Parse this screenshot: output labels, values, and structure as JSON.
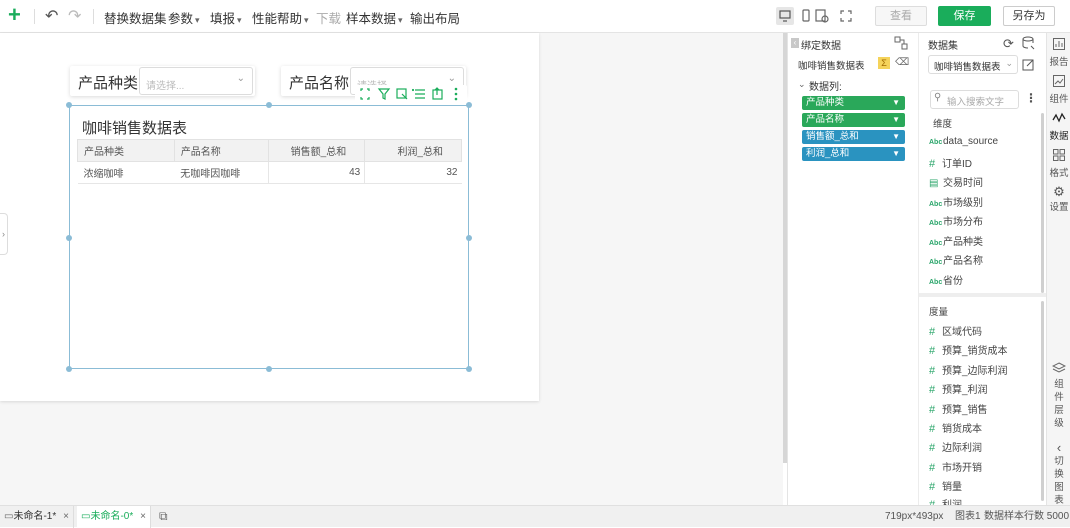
{
  "toolbar": {
    "add": "+",
    "undo": "↶",
    "redo": "↷",
    "menu": [
      "替换数据集",
      "参数",
      "填报",
      "性能帮助",
      "下载",
      "样本数据",
      "输出布局"
    ],
    "view_btn": "查看",
    "save_btn": "保存",
    "save_as_btn": "另存为"
  },
  "canvas": {
    "filter1": {
      "label": "产品种类",
      "placeholder": "请选择..."
    },
    "filter2": {
      "label": "产品名称",
      "placeholder": "请选择..."
    },
    "table_title": "咖啡销售数据表",
    "columns": [
      "产品种类",
      "产品名称",
      "销售额_总和",
      "利润_总和"
    ],
    "rows": [
      [
        "浓缩咖啡",
        "无咖啡因咖啡",
        "43",
        "32"
      ]
    ]
  },
  "bind_panel": {
    "title": "绑定数据",
    "dataset_name": "咖啡销售数据表",
    "section": "数据列:",
    "fields": [
      {
        "label": "产品种类",
        "color": "#2aa85a"
      },
      {
        "label": "产品名称",
        "color": "#2aa85a"
      },
      {
        "label": "销售额_总和",
        "color": "#2a93c0"
      },
      {
        "label": "利润_总和",
        "color": "#2a93c0"
      }
    ]
  },
  "dataset_panel": {
    "title": "数据集",
    "selected": "咖啡销售数据表",
    "search_placeholder": "输入搜索文字",
    "dim_title": "维度",
    "dimensions": [
      {
        "type": "Abc",
        "name": "data_source"
      },
      {
        "type": "#",
        "name": "订单ID"
      },
      {
        "type": "date",
        "name": "交易时间"
      },
      {
        "type": "Abc",
        "name": "市场级别"
      },
      {
        "type": "Abc",
        "name": "市场分布"
      },
      {
        "type": "Abc",
        "name": "产品种类"
      },
      {
        "type": "Abc",
        "name": "产品名称"
      },
      {
        "type": "Abc",
        "name": "省份"
      }
    ],
    "measure_title": "度量",
    "measures": [
      "区域代码",
      "预算_销货成本",
      "预算_边际利润",
      "预算_利润",
      "预算_销售",
      "销货成本",
      "边际利润",
      "市场开销",
      "销量",
      "利润"
    ]
  },
  "rail": {
    "report": "报告",
    "component": "组件",
    "data": "数据",
    "format": "格式",
    "settings": "设置",
    "layers": "组件层级",
    "switch": "切换图表"
  },
  "status": {
    "tab1": "未命名-1*",
    "tab2": "未命名-0*",
    "size": "719px*493px",
    "chart": "图表1",
    "rows": "数据样本行数 5000"
  },
  "colors": {
    "accent": "#1aad5b",
    "selection": "#8bbcd6",
    "dim": "#2aa85a",
    "measure": "#2a93c0"
  }
}
